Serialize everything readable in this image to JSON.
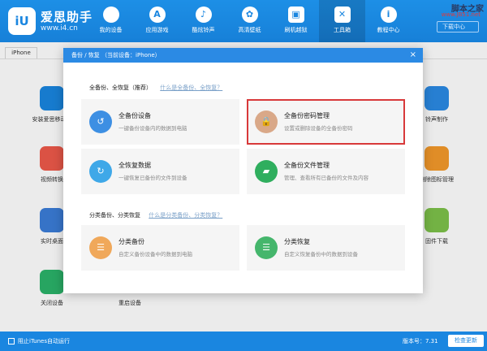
{
  "app": {
    "brand": "爱思助手",
    "site": "www.i4.cn",
    "logo_text": "iU",
    "download_label": "下载中心"
  },
  "watermark": {
    "line1": "脚本之家",
    "line2": "www.JB51.net"
  },
  "nav": [
    {
      "label": "我的设备",
      "icon": "apple-icon",
      "glyph": ""
    },
    {
      "label": "应用游戏",
      "icon": "appstore-icon",
      "glyph": "A"
    },
    {
      "label": "酷炫铃声",
      "icon": "bell-icon",
      "glyph": "♪"
    },
    {
      "label": "高清壁纸",
      "icon": "flower-icon",
      "glyph": "✿"
    },
    {
      "label": "刷机越狱",
      "icon": "box-icon",
      "glyph": "▣"
    },
    {
      "label": "工具箱",
      "icon": "tools-icon",
      "glyph": "✕"
    },
    {
      "label": "教程中心",
      "icon": "info-icon",
      "glyph": "i"
    }
  ],
  "device_tab": "iPhone",
  "apps": [
    {
      "label": "安装爱思移动版",
      "color": "#1a86e0"
    },
    {
      "label": "视频转换",
      "color": "#ee5a4a"
    },
    {
      "label": "实时桌面",
      "color": "#3b7dd8"
    },
    {
      "label": "关闭设备",
      "color": "#2bb36a"
    },
    {
      "label": "重启设备",
      "color": "#f5a623"
    },
    {
      "label": "铃声制作",
      "color": "#2b8ae4"
    },
    {
      "label": "删除图标管理",
      "color": "#f39a2b"
    },
    {
      "label": "固件下载",
      "color": "#7dc24a"
    }
  ],
  "dialog": {
    "title": "备份 / 恢复   （当前设备：iPhone）",
    "close": "×",
    "section1": {
      "title": "全备份、全恢复（推荐）",
      "link": "什么是全备份、全恢复？"
    },
    "section2": {
      "title": "分类备份、分类恢复",
      "link": "什么是分类备份、分类恢复？"
    },
    "cards": [
      {
        "title": "全备份设备",
        "desc": "一键备份设备内的数据到电脑",
        "icon": "clock-backup-icon",
        "color": "#3d8fe3",
        "glyph": "↺"
      },
      {
        "title": "全备份密码管理",
        "desc": "设置或删除设备的全备份密码",
        "icon": "lock-icon",
        "color": "#d9a888",
        "glyph": "🔒"
      },
      {
        "title": "全恢复数据",
        "desc": "一键恢复已备份的文件到设备",
        "icon": "clock-restore-icon",
        "color": "#3fa8e8",
        "glyph": "↻"
      },
      {
        "title": "全备份文件管理",
        "desc": "管理、查看所有已备份的文件及内容",
        "icon": "folder-icon",
        "color": "#2fae5e",
        "glyph": "▰"
      },
      {
        "title": "分类备份",
        "desc": "自定义备份设备中的数据到电脑",
        "icon": "category-backup-icon",
        "color": "#f0a85a",
        "glyph": "☰"
      },
      {
        "title": "分类恢复",
        "desc": "自定义恢复备份中的数据到设备",
        "icon": "category-restore-icon",
        "color": "#45b66c",
        "glyph": "☰"
      }
    ]
  },
  "bottom": {
    "itunes_label": "阻止iTunes自动运行",
    "version": "版本号：7.31",
    "update_label": "检查更新"
  }
}
